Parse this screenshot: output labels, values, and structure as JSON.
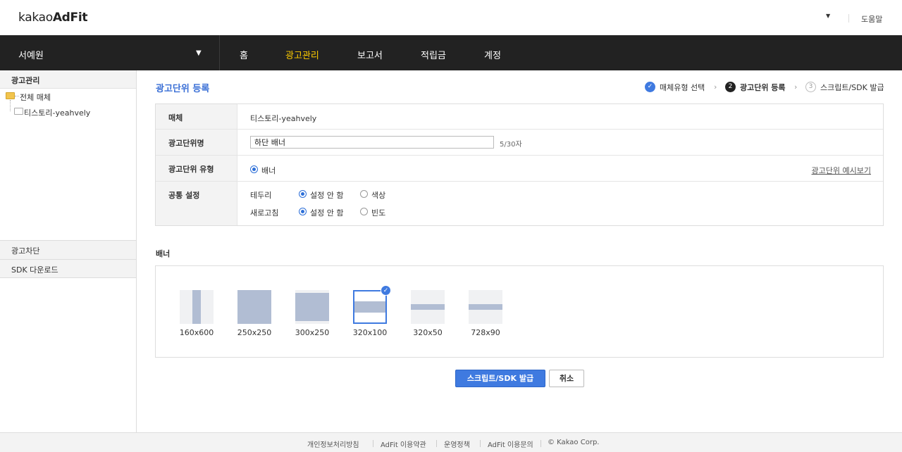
{
  "header": {
    "logo_light": "kakao",
    "logo_bold": "AdFit",
    "caret": "▼",
    "help_label": "도움말"
  },
  "nav": {
    "org_name": "서예원",
    "org_caret": "▼",
    "items": [
      {
        "label": "홈",
        "active": false
      },
      {
        "label": "광고관리",
        "active": true
      },
      {
        "label": "보고서",
        "active": false
      },
      {
        "label": "적립금",
        "active": false
      },
      {
        "label": "계정",
        "active": false
      }
    ],
    "active_color": "#ffcd00"
  },
  "sidebar": {
    "title": "광고관리",
    "tree": {
      "root": "전체 매체",
      "child": "티스토리-yeahvely"
    },
    "menu": [
      "광고차단",
      "SDK 다운로드"
    ]
  },
  "main": {
    "title": "광고단위 등록",
    "steps": [
      {
        "num": "✓",
        "label": "매체유형 선택",
        "state": "done"
      },
      {
        "num": "2",
        "label": "광고단위 등록",
        "state": "current"
      },
      {
        "num": "3",
        "label": "스크립트/SDK 발급",
        "state": "todo"
      }
    ],
    "step_chevron": "›",
    "form": {
      "media_label": "매체",
      "media_value": "티스토리-yeahvely",
      "unit_name_label": "광고단위명",
      "unit_name_value": "하단 배너",
      "unit_name_count": "5/30자",
      "unit_type_label": "광고단위 유형",
      "unit_type_option": "배너",
      "example_link": "광고단위 예시보기",
      "common_label": "공통 설정",
      "border_label": "테두리",
      "border_options": [
        "설정 안 함",
        "색상"
      ],
      "border_selected": 0,
      "refresh_label": "새로고침",
      "refresh_options": [
        "설정 안 함",
        "빈도"
      ],
      "refresh_selected": 0
    },
    "banner_section_title": "배너",
    "banners": [
      {
        "size": "160x600",
        "selected": false
      },
      {
        "size": "250x250",
        "selected": false
      },
      {
        "size": "300x250",
        "selected": false
      },
      {
        "size": "320x100",
        "selected": true
      },
      {
        "size": "320x50",
        "selected": false
      },
      {
        "size": "728x90",
        "selected": false
      }
    ],
    "submit_button": "스크립트/SDK 발급",
    "cancel_button": "취소",
    "accent_color": "#3f7ae0"
  },
  "footer": {
    "links": [
      "개인정보처리방침",
      "AdFit 이용약관",
      "운영정책",
      "AdFit 이용문의"
    ],
    "copyright": "© Kakao Corp."
  }
}
